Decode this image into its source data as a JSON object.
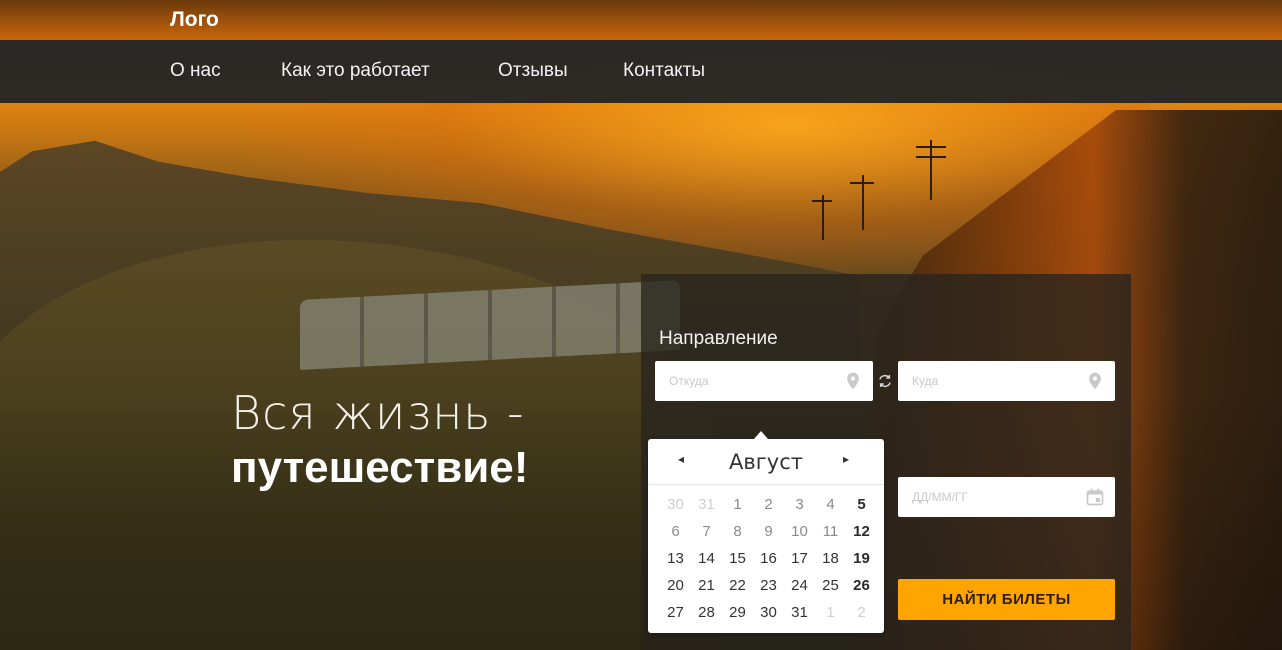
{
  "header": {
    "logo": "Лого",
    "nav": [
      {
        "label": "О нас"
      },
      {
        "label": "Как это работает"
      },
      {
        "label": "Отзывы"
      },
      {
        "label": "Контакты"
      }
    ]
  },
  "hero": {
    "line1": "Вся жизнь -",
    "line2": "путешествие!"
  },
  "search": {
    "title": "Направление",
    "from_placeholder": "Откуда",
    "to_placeholder": "Куда",
    "date_placeholder": "ДД/ММ/ГГ",
    "submit_label": "НАЙТИ БИЛЕТЫ",
    "accent_color": "#ffa400"
  },
  "calendar": {
    "month": "Август",
    "prev_icon": "◂",
    "next_icon": "▸",
    "weeks": [
      [
        {
          "d": "30",
          "s": "muted"
        },
        {
          "d": "31",
          "s": "muted"
        },
        {
          "d": "1",
          "s": "dim"
        },
        {
          "d": "2",
          "s": "dim"
        },
        {
          "d": "3",
          "s": "dim"
        },
        {
          "d": "4",
          "s": "dim"
        },
        {
          "d": "5",
          "s": "bolddim"
        }
      ],
      [
        {
          "d": "6",
          "s": "dim"
        },
        {
          "d": "7",
          "s": "dim"
        },
        {
          "d": "8",
          "s": "dim"
        },
        {
          "d": "9",
          "s": "dim"
        },
        {
          "d": "10",
          "s": "dim"
        },
        {
          "d": "11",
          "s": "dim"
        },
        {
          "d": "12",
          "s": "bold"
        }
      ],
      [
        {
          "d": "13",
          "s": ""
        },
        {
          "d": "14",
          "s": ""
        },
        {
          "d": "15",
          "s": ""
        },
        {
          "d": "16",
          "s": ""
        },
        {
          "d": "17",
          "s": ""
        },
        {
          "d": "18",
          "s": ""
        },
        {
          "d": "19",
          "s": "bold"
        }
      ],
      [
        {
          "d": "20",
          "s": ""
        },
        {
          "d": "21",
          "s": ""
        },
        {
          "d": "22",
          "s": ""
        },
        {
          "d": "23",
          "s": ""
        },
        {
          "d": "24",
          "s": ""
        },
        {
          "d": "25",
          "s": ""
        },
        {
          "d": "26",
          "s": "bold"
        }
      ],
      [
        {
          "d": "27",
          "s": ""
        },
        {
          "d": "28",
          "s": ""
        },
        {
          "d": "29",
          "s": ""
        },
        {
          "d": "30",
          "s": ""
        },
        {
          "d": "31",
          "s": ""
        },
        {
          "d": "1",
          "s": "muted"
        },
        {
          "d": "2",
          "s": "muted"
        }
      ]
    ]
  },
  "icons": {
    "from_field": "map-pin-icon",
    "to_field": "map-pin-icon",
    "swap": "swap-icon",
    "date_field": "calendar-icon"
  }
}
